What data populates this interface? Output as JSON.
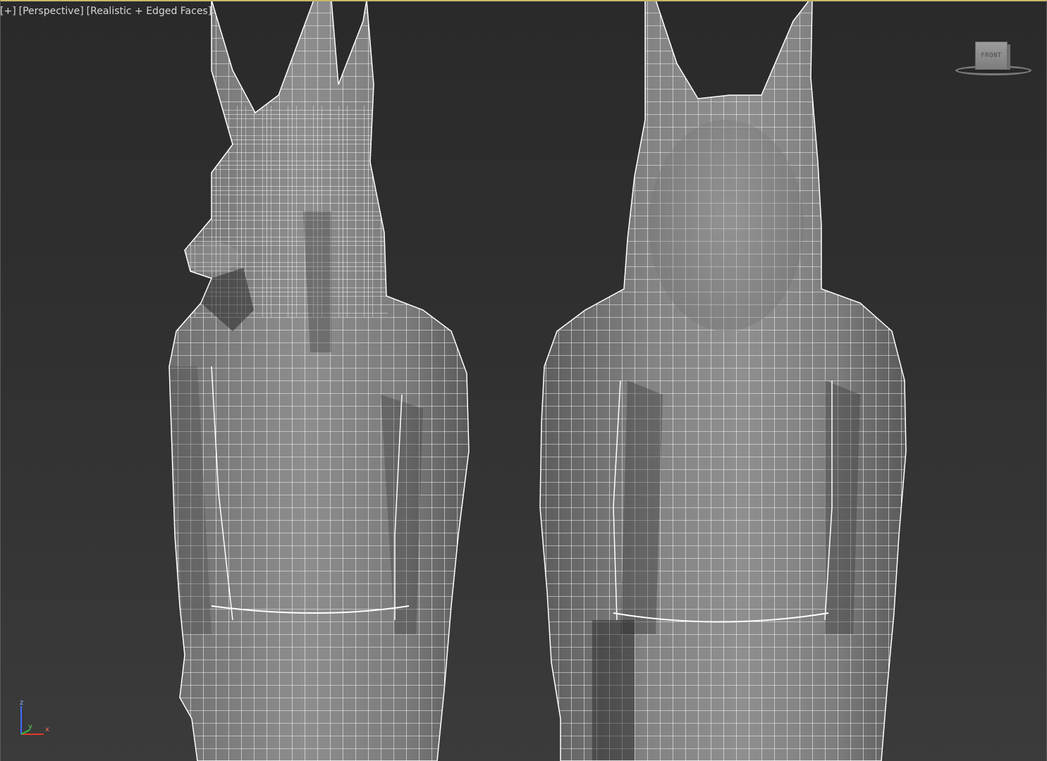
{
  "viewport": {
    "label_plus": "[+]",
    "label_view": "[Perspective]",
    "label_shading": "[Realistic + Edged Faces]"
  },
  "viewcube": {
    "face_label": "FRONT",
    "icon": "viewcube-icon"
  },
  "axis_tripod": {
    "z_label": "z",
    "y_label": "y",
    "x_label": "x",
    "z_color": "#3f6bff",
    "y_color": "#2fbf3f",
    "x_color": "#e03a2a"
  },
  "scene": {
    "models": [
      "anubis-three-quarter-view",
      "anubis-back-view"
    ],
    "mesh_color": "#8a8a8a",
    "wire_color": "#ffffff"
  }
}
